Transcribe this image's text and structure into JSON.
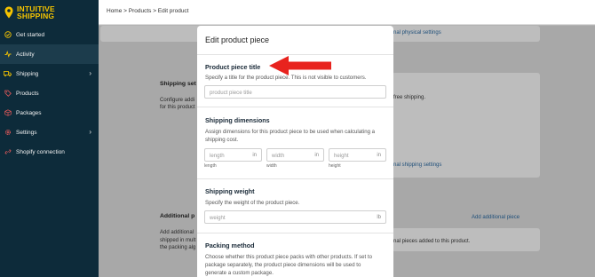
{
  "brand": {
    "line1": "INTUITIVE",
    "line2": "SHIPPING"
  },
  "sidebar": {
    "items": [
      {
        "label": "Get started",
        "icon": "check-circle-icon"
      },
      {
        "label": "Activity",
        "icon": "pulse-icon"
      },
      {
        "label": "Shipping",
        "icon": "truck-icon"
      },
      {
        "label": "Products",
        "icon": "tag-icon"
      },
      {
        "label": "Packages",
        "icon": "box-icon"
      },
      {
        "label": "Settings",
        "icon": "gear-icon"
      },
      {
        "label": "Shopify connection",
        "icon": "link-icon"
      }
    ]
  },
  "breadcrumb": "Home > Products > Edit product",
  "background": {
    "link_top": "nal physical settings",
    "shipping_title": "Shipping set",
    "shipping_desc1": "Configure addi",
    "shipping_desc2": "for this product",
    "free_shipping": "free shipping.",
    "shipping_link": "nal shipping settings",
    "additional_title": "Additional p",
    "additional_desc1": "Add additional",
    "additional_desc2": "shipped in mult",
    "additional_desc3": "the packing alg",
    "add_piece_link": "Add additional piece",
    "pieces_added": "nal pieces added to this product."
  },
  "modal": {
    "title": "Edit product piece",
    "title_section": {
      "heading": "Product piece title",
      "desc": "Specify a title for the product piece. This is not visible to customers.",
      "placeholder": "product piece title"
    },
    "dimensions": {
      "heading": "Shipping dimensions",
      "desc": "Assign dimensions for this product piece to be used when calculating a shipping cost.",
      "fields": [
        {
          "placeholder": "length",
          "unit": "in",
          "label": "length"
        },
        {
          "placeholder": "width",
          "unit": "in",
          "label": "width"
        },
        {
          "placeholder": "height",
          "unit": "in",
          "label": "height"
        }
      ]
    },
    "weight": {
      "heading": "Shipping weight",
      "desc": "Specify the weight of the product piece.",
      "placeholder": "weight",
      "unit": "lb"
    },
    "packing": {
      "heading": "Packing method",
      "desc": "Choose whether this product piece packs with other products. If set to package separately, the product piece dimensions will be used to generate a custom package."
    }
  },
  "colors": {
    "sidebar_bg": "#0d2b3a",
    "brand_yellow": "#f5c400",
    "annotation_arrow": "#e8231e"
  }
}
